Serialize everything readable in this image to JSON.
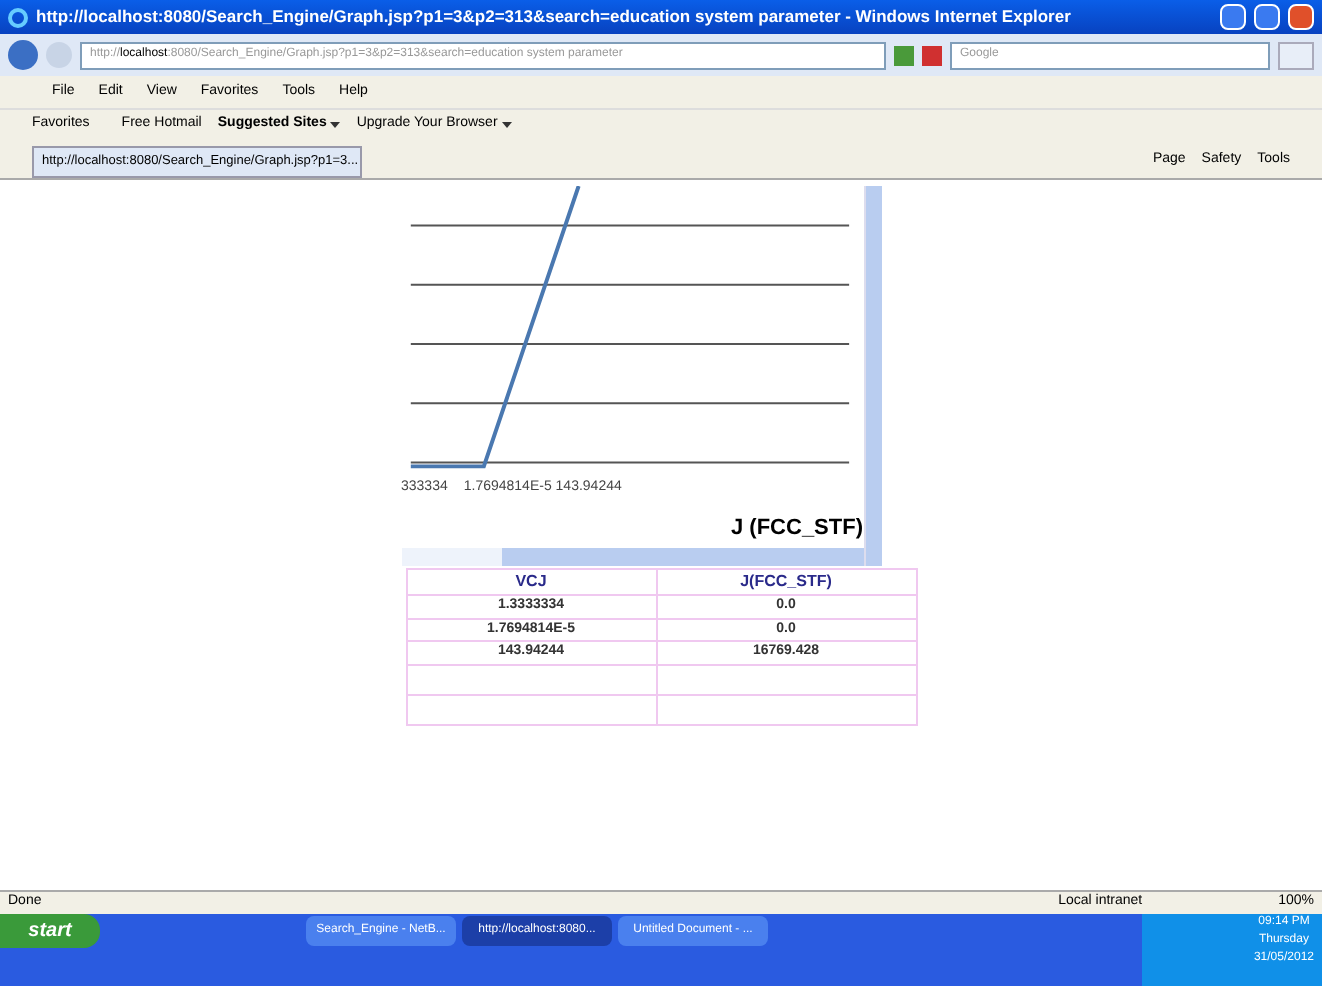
{
  "window": {
    "title": "http://localhost:8080/Search_Engine/Graph.jsp?p1=3&p2=313&search=education system parameter - Windows Internet Explorer"
  },
  "address_bar": {
    "url_prefix": "http://",
    "url_host": "localhost",
    "url_rest": ":8080/Search_Engine/Graph.jsp?p1=3&p2=313&search=education system parameter",
    "search_placeholder": "Google"
  },
  "menu": [
    "File",
    "Edit",
    "View",
    "Favorites",
    "Tools",
    "Help"
  ],
  "favorites_bar": {
    "favorites": "Favorites",
    "links": [
      {
        "label": "Free Hotmail",
        "bold": false,
        "dropdown": false
      },
      {
        "label": "Suggested Sites",
        "bold": true,
        "dropdown": true
      },
      {
        "label": "Upgrade Your Browser",
        "bold": false,
        "dropdown": true
      }
    ]
  },
  "tab": {
    "label": "http://localhost:8080/Search_Engine/Graph.jsp?p1=3..."
  },
  "command_bar": [
    "Page",
    "Safety",
    "Tools"
  ],
  "chart": {
    "x_labels": [
      "333334",
      "1.7694814E-5 143.94244"
    ],
    "axis_title": "J (FCC_STF)"
  },
  "table": {
    "columns": [
      "VCJ",
      "J(FCC_STF)"
    ],
    "rows": [
      [
        "1.3333334",
        "0.0"
      ],
      [
        "1.7694814E-5",
        "0.0"
      ],
      [
        "143.94244",
        "16769.428"
      ],
      [
        "",
        ""
      ],
      [
        "",
        ""
      ]
    ]
  },
  "status_bar": {
    "text": "Done",
    "zone": "Local intranet",
    "zoom": "100%"
  },
  "taskbar": {
    "start": "start",
    "tasks": [
      {
        "label": "Search_Engine - NetB...",
        "selected": false
      },
      {
        "label": "http://localhost:8080...",
        "selected": true
      },
      {
        "label": "Untitled Document - ...",
        "selected": false
      }
    ],
    "time": "09:14 PM",
    "day": "Thursday",
    "date": "31/05/2012"
  }
}
